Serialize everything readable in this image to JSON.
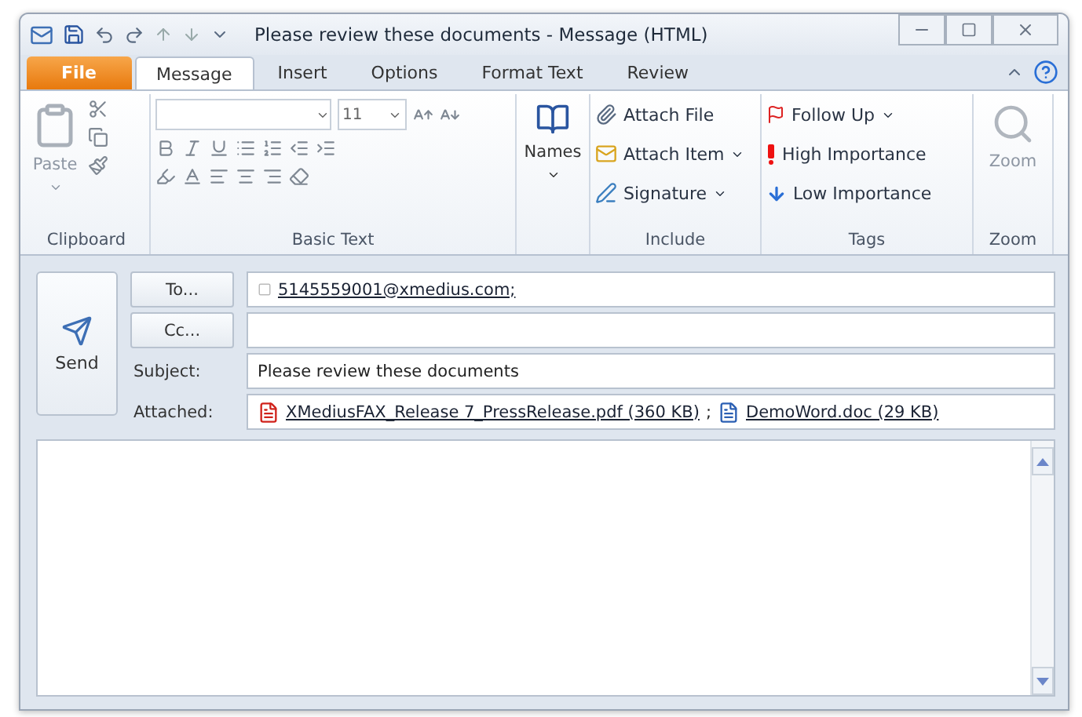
{
  "window": {
    "title": "Please review these documents - Message (HTML)"
  },
  "tabs": [
    {
      "label": "File",
      "kind": "file",
      "selected": false
    },
    {
      "label": "Message",
      "kind": "tab",
      "selected": true
    },
    {
      "label": "Insert",
      "kind": "tab",
      "selected": false
    },
    {
      "label": "Options",
      "kind": "tab",
      "selected": false
    },
    {
      "label": "Format Text",
      "kind": "tab",
      "selected": false
    },
    {
      "label": "Review",
      "kind": "tab",
      "selected": false
    }
  ],
  "ribbon": {
    "clipboard": {
      "label": "Clipboard",
      "paste": {
        "label": "Paste",
        "disabled": true
      }
    },
    "basic_text": {
      "label": "Basic Text",
      "font_size": "11"
    },
    "names": {
      "label": "Names"
    },
    "include": {
      "label": "Include",
      "items": [
        {
          "label": "Attach File",
          "kind": "file",
          "dropdown": false
        },
        {
          "label": "Attach Item",
          "kind": "item",
          "dropdown": true
        },
        {
          "label": "Signature",
          "kind": "signature",
          "dropdown": true
        }
      ]
    },
    "tags": {
      "label": "Tags",
      "items": [
        {
          "label": "Follow Up",
          "kind": "flag",
          "dropdown": true
        },
        {
          "label": "High Importance",
          "kind": "high",
          "dropdown": false
        },
        {
          "label": "Low Importance",
          "kind": "low",
          "dropdown": false
        }
      ]
    },
    "zoom": {
      "label": "Zoom",
      "button": {
        "label": "Zoom",
        "disabled": true
      }
    }
  },
  "form": {
    "send": "Send",
    "to_button": "To...",
    "cc_button": "Cc...",
    "to": "5145559001@xmedius.com;",
    "subject_label": "Subject:",
    "subject": "Please review these documents",
    "attached_label": "Attached:",
    "attachments": [
      {
        "name": "XMediusFAX_Release 7_PressRelease.pdf (360 KB)",
        "kind": "pdf"
      },
      {
        "name": "DemoWord.doc (29 KB)",
        "kind": "doc"
      }
    ],
    "separator": ";"
  }
}
